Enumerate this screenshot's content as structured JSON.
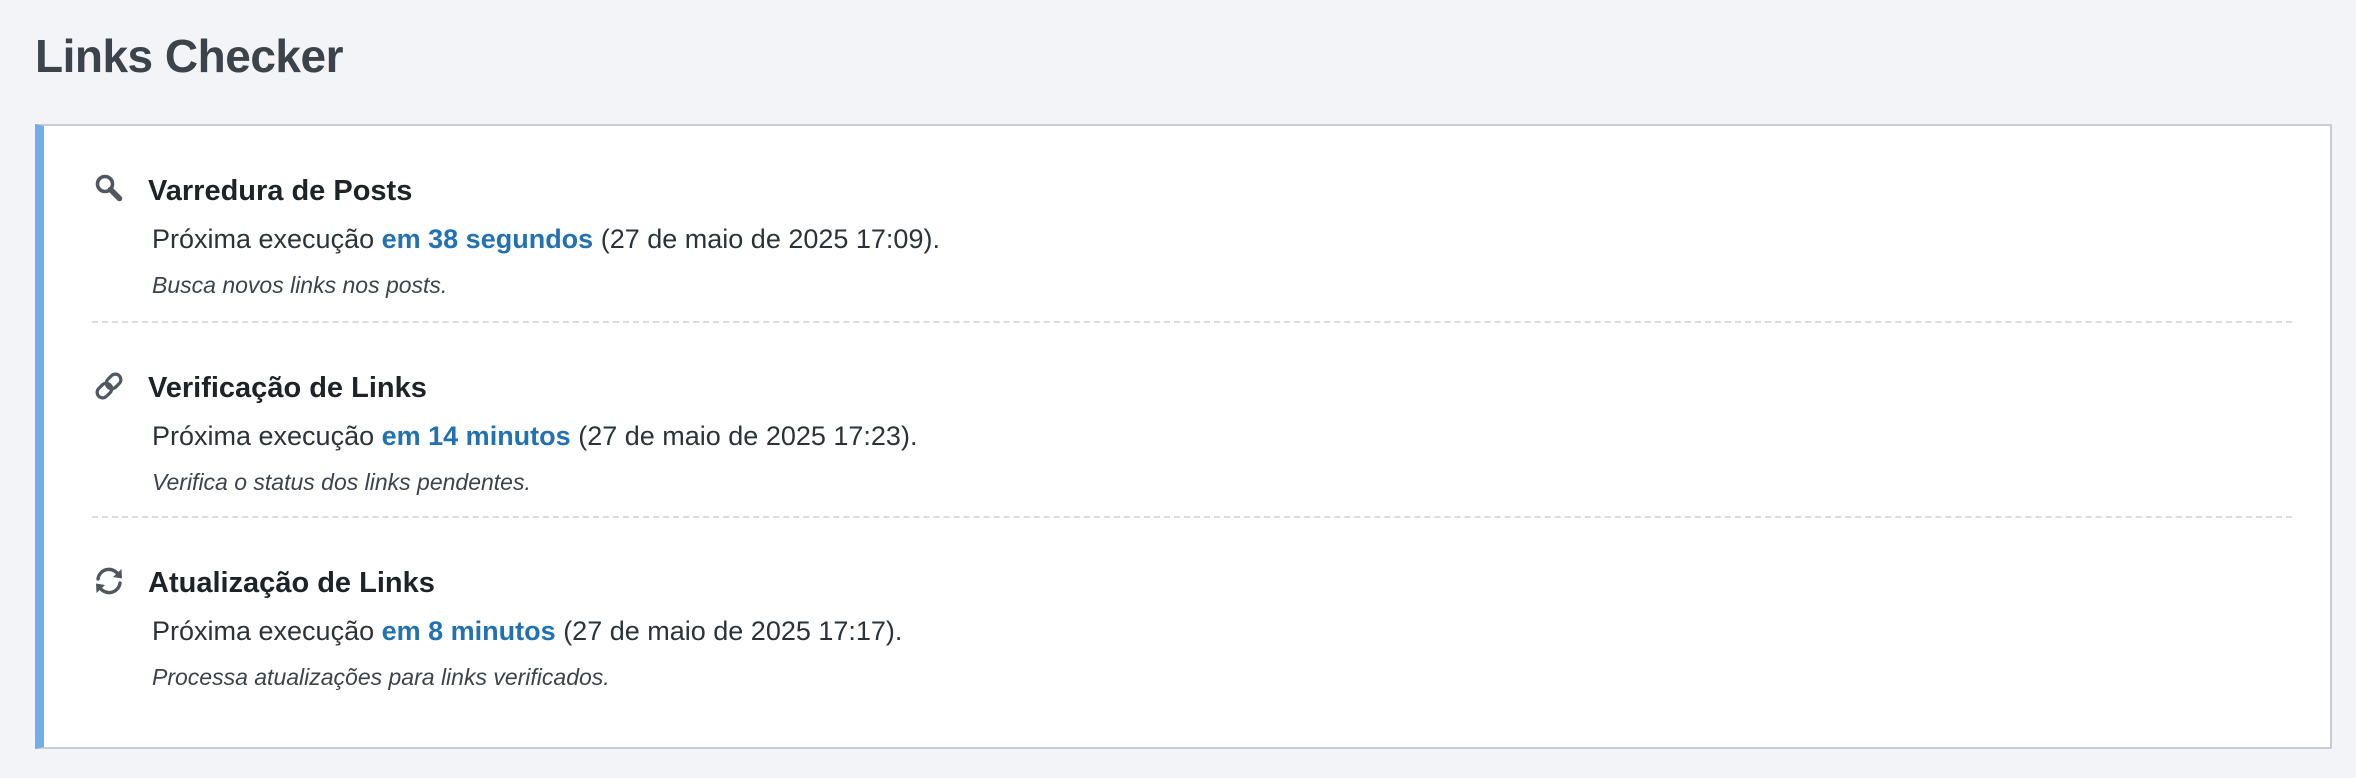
{
  "page": {
    "title": "Links Checker"
  },
  "colors": {
    "accent": "#72aee6",
    "link": "#2271b1",
    "background": "#f3f4f8",
    "panel": "#ffffff"
  },
  "tasks": [
    {
      "icon": "search-icon",
      "title": "Varredura de Posts",
      "schedule_prefix": "Próxima execução",
      "relative": "em 38 segundos",
      "absolute": "(27 de maio de 2025 17:09).",
      "description": "Busca novos links nos posts."
    },
    {
      "icon": "link-icon",
      "title": "Verificação de Links",
      "schedule_prefix": "Próxima execução",
      "relative": "em 14 minutos",
      "absolute": "(27 de maio de 2025 17:23).",
      "description": "Verifica o status dos links pendentes."
    },
    {
      "icon": "refresh-icon",
      "title": "Atualização de Links",
      "schedule_prefix": "Próxima execução",
      "relative": "em 8 minutos",
      "absolute": "(27 de maio de 2025 17:17).",
      "description": "Processa atualizações para links verificados."
    }
  ]
}
